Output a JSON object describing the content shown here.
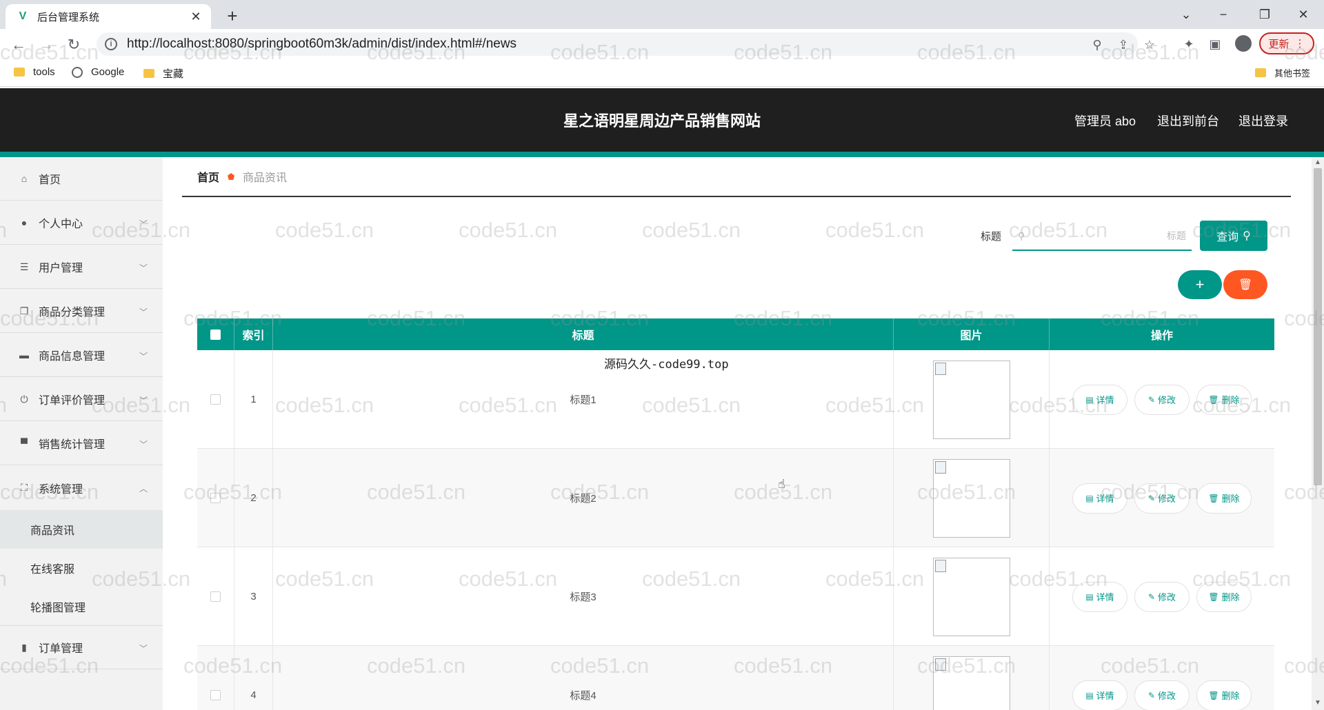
{
  "browser": {
    "tab_title": "后台管理系统",
    "url": "http://localhost:8080/springboot60m3k/admin/dist/index.html#/news",
    "update_label": "更新",
    "bookmarks": [
      "tools",
      "Google",
      "宝藏"
    ],
    "other_bookmarks": "其他书签"
  },
  "header": {
    "site_title": "星之语明星周边产品销售网站",
    "admin_label": "管理员 abo",
    "back_front": "退出到前台",
    "logout": "退出登录"
  },
  "sidebar": {
    "items": [
      {
        "label": "首页",
        "icon": "home-icon"
      },
      {
        "label": "个人中心",
        "icon": "user-icon"
      },
      {
        "label": "用户管理",
        "icon": "list-icon"
      },
      {
        "label": "商品分类管理",
        "icon": "copy-icon"
      },
      {
        "label": "商品信息管理",
        "icon": "briefcase-icon"
      },
      {
        "label": "订单评价管理",
        "icon": "power-icon"
      },
      {
        "label": "销售统计管理",
        "icon": "card-icon"
      },
      {
        "label": "系统管理",
        "icon": "expand-icon"
      },
      {
        "label": "订单管理",
        "icon": "chart-icon"
      }
    ],
    "sub_items": [
      "商品资讯",
      "在线客服",
      "轮播图管理"
    ]
  },
  "breadcrumb": {
    "home": "首页",
    "current": "商品资讯"
  },
  "search": {
    "label": "标题",
    "placeholder": "标题",
    "button": "查询"
  },
  "table": {
    "headers": [
      "索引",
      "标题",
      "图片",
      "操作"
    ],
    "rows": [
      {
        "index": "1",
        "title": "标题1"
      },
      {
        "index": "2",
        "title": "标题2"
      },
      {
        "index": "3",
        "title": "标题3"
      },
      {
        "index": "4",
        "title": "标题4"
      }
    ],
    "actions": {
      "detail": "详情",
      "edit": "修改",
      "delete": "删除"
    }
  },
  "overlay_text": "源码久久-code99.top",
  "watermark": "code51.cn",
  "colors": {
    "primary": "#009688",
    "danger": "#ff5722",
    "header_bg": "#1f1f1f"
  }
}
